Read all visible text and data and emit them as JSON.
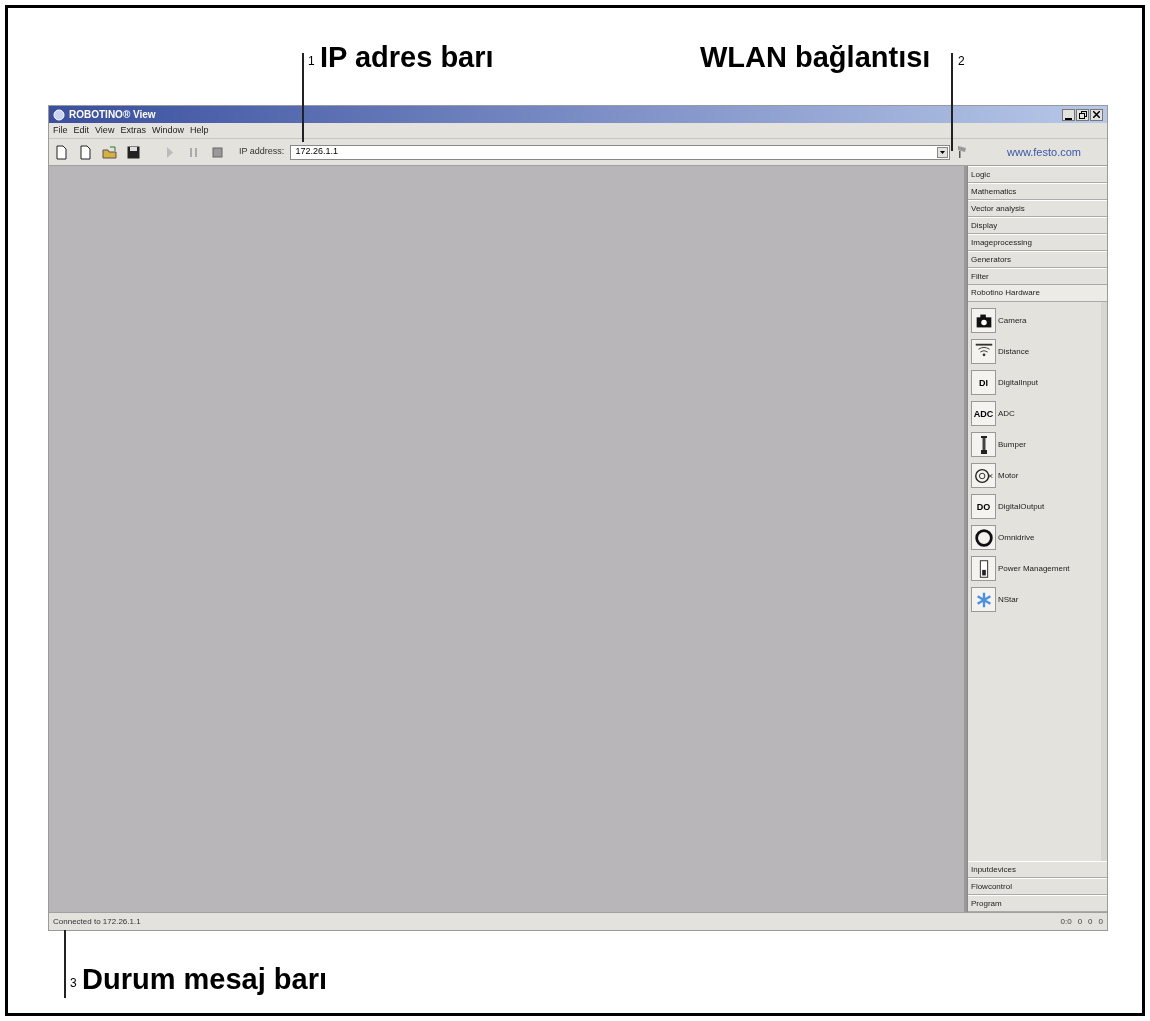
{
  "annotations": [
    {
      "number": "1",
      "label": "IP adres barı"
    },
    {
      "number": "2",
      "label": "WLAN bağlantısı"
    },
    {
      "number": "3",
      "label": "Durum mesaj barı"
    }
  ],
  "window": {
    "title": "ROBOTINO® View"
  },
  "menu": [
    "File",
    "Edit",
    "View",
    "Extras",
    "Window",
    "Help"
  ],
  "toolbar": {
    "buttons": [
      {
        "kind": "new"
      },
      {
        "kind": "new"
      },
      {
        "kind": "open"
      },
      {
        "kind": "save"
      },
      {
        "kind": "play"
      },
      {
        "kind": "pause"
      },
      {
        "kind": "stop"
      }
    ],
    "ip_label": "IP address:",
    "ip_value": "172.26.1.1",
    "link": "www.festo.com"
  },
  "categories": [
    {
      "label": "Logic",
      "expanded": false
    },
    {
      "label": "Mathematics",
      "expanded": false
    },
    {
      "label": "Vector analysis",
      "expanded": false
    },
    {
      "label": "Display",
      "expanded": false
    },
    {
      "label": "Imageprocessing",
      "expanded": false
    },
    {
      "label": "Generators",
      "expanded": false
    },
    {
      "label": "Filter",
      "expanded": false
    },
    {
      "label": "Robotino Hardware",
      "expanded": true,
      "children": [
        {
          "label": "Camera",
          "kind": "camera"
        },
        {
          "label": "Distance",
          "kind": "distance"
        },
        {
          "label": "DigitalInput",
          "kind": "text",
          "icon_text": "DI"
        },
        {
          "label": "ADC",
          "kind": "text",
          "icon_text": "ADC"
        },
        {
          "label": "Bumper",
          "kind": "bumper"
        },
        {
          "label": "Motor",
          "kind": "motor"
        },
        {
          "label": "DigitalOutput",
          "kind": "text",
          "icon_text": "DO"
        },
        {
          "label": "Omnidrive",
          "kind": "omnidrive"
        },
        {
          "label": "Power Management",
          "kind": "power"
        },
        {
          "label": "NStar",
          "kind": "star"
        }
      ]
    },
    {
      "label": "Inputdevices",
      "expanded": false
    },
    {
      "label": "Flowcontrol",
      "expanded": false
    },
    {
      "label": "Program",
      "expanded": false
    }
  ],
  "status_bar": {
    "message": "Connected to 172.26.1.1",
    "counters": [
      "0:0",
      "0",
      "0",
      "0"
    ]
  }
}
